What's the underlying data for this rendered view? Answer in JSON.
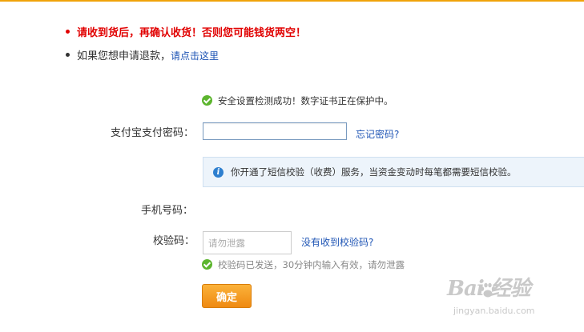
{
  "notices": {
    "warning": "请收到货后，再确认收货！否则您可能钱货两空！",
    "refund_prefix": "如果您想申请退款，",
    "refund_link": "请点击这里"
  },
  "security_status": "安全设置检测成功！数字证书正在保护中。",
  "password": {
    "label": "支付宝支付密码：",
    "value": "",
    "forgot_link": "忘记密码?"
  },
  "sms_info": "你开通了短信校验（收费）服务，当资金变动时每笔都需要短信校验。",
  "phone": {
    "label": "手机号码："
  },
  "verification": {
    "label": "校验码：",
    "placeholder": "请勿泄露",
    "no_code_link": "没有收到校验码?",
    "status": "校验码已发送，30分钟内输入有效，请勿泄露"
  },
  "confirm_button": "确定",
  "watermark": {
    "text": "Bai  经验",
    "sub": "jingyan.baidu.com"
  },
  "colors": {
    "accent": "#f0a30a",
    "warning": "#e10000",
    "link": "#1f55b5",
    "success": "#5cb52e",
    "info": "#2e7fcf"
  },
  "icons": [
    "check-circle-icon",
    "info-icon",
    "paw-icon"
  ]
}
